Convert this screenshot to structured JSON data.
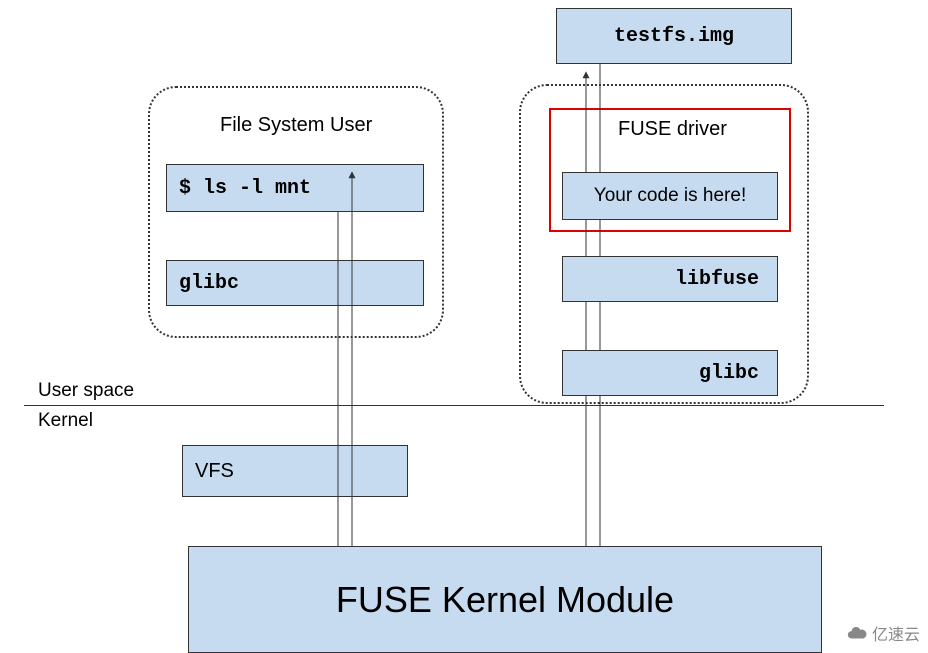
{
  "boxes": {
    "testfs": "testfs.img",
    "fs_user_title": "File System User",
    "ls_cmd": "$ ls -l mnt",
    "glibc_left": "glibc",
    "fuse_driver_title": "FUSE driver",
    "your_code": "Your code is here!",
    "libfuse": "libfuse",
    "glibc_right": "glibc",
    "vfs": "VFS",
    "kernel_module": "FUSE Kernel Module"
  },
  "labels": {
    "user_space": "User space",
    "kernel": "Kernel"
  },
  "watermark": "亿速云"
}
